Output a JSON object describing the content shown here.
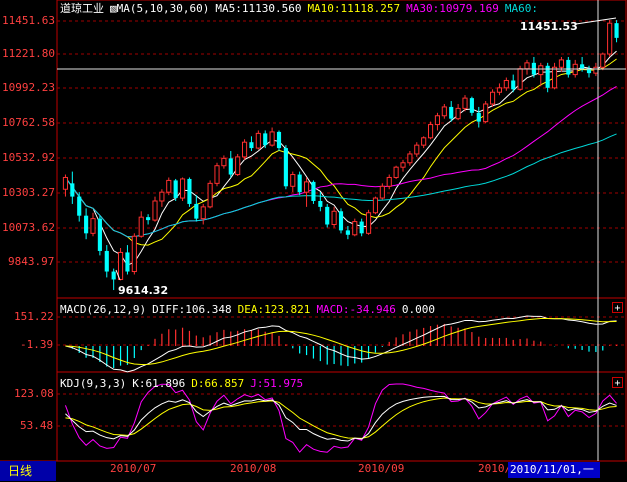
{
  "title": "道琼工业",
  "ma_header": {
    "params": "MA(5,10,30,60)",
    "ma5": "MA5:11130.560",
    "ma10": "MA10:11118.257",
    "ma30": "MA30:10979.169",
    "ma60": "MA60:"
  },
  "macd_header": {
    "params": "MACD(26,12,9)",
    "diff": "DIFF:106.348",
    "dea": "DEA:123.821",
    "macd": "MACD:-34.946",
    "extra": "0.000"
  },
  "kdj_header": {
    "params": "KDJ(9,3,3)",
    "k": "K:61.896",
    "d": "D:66.857",
    "j": "J:51.975"
  },
  "price_axis": [
    "11451.63",
    "11221.80",
    "10992.23",
    "10762.58",
    "10532.92",
    "10303.27",
    "10073.62",
    "9843.97"
  ],
  "macd_axis": [
    "151.22",
    "-1.39"
  ],
  "kdj_axis": [
    "123.08",
    "53.48"
  ],
  "x_axis": [
    "2010/07",
    "2010/08",
    "2010/09",
    "2010/10"
  ],
  "annotations": {
    "high": "11451.53",
    "low": "9614.32"
  },
  "bottom": {
    "period_tab": "日线",
    "cursor_date": "2010/11/01,一"
  },
  "plus_icon": "+",
  "colors": {
    "up": "#ff3030",
    "down": "#00ffff",
    "ma5": "#ffffff",
    "ma10": "#ffff00",
    "ma30": "#ff00ff",
    "ma60": "#00d8d8",
    "grid": "#a00000"
  },
  "chart_data": {
    "type": "candlestick",
    "price_range": [
      9614.32,
      11451.53
    ],
    "candles": [
      {
        "o": 10300,
        "h": 10400,
        "l": 10250,
        "c": 10380
      },
      {
        "o": 10340,
        "h": 10420,
        "l": 10200,
        "c": 10250
      },
      {
        "o": 10250,
        "h": 10280,
        "l": 10080,
        "c": 10120
      },
      {
        "o": 10120,
        "h": 10170,
        "l": 9960,
        "c": 10000
      },
      {
        "o": 10000,
        "h": 10140,
        "l": 9980,
        "c": 10100
      },
      {
        "o": 10100,
        "h": 10120,
        "l": 9850,
        "c": 9880
      },
      {
        "o": 9880,
        "h": 9920,
        "l": 9700,
        "c": 9740
      },
      {
        "o": 9740,
        "h": 9760,
        "l": 9614,
        "c": 9686
      },
      {
        "o": 9686,
        "h": 9900,
        "l": 9680,
        "c": 9870
      },
      {
        "o": 9870,
        "h": 9920,
        "l": 9720,
        "c": 9740
      },
      {
        "o": 9740,
        "h": 10000,
        "l": 9720,
        "c": 9980
      },
      {
        "o": 9980,
        "h": 10150,
        "l": 9970,
        "c": 10110
      },
      {
        "o": 10110,
        "h": 10130,
        "l": 10060,
        "c": 10090
      },
      {
        "o": 10090,
        "h": 10250,
        "l": 10080,
        "c": 10220
      },
      {
        "o": 10220,
        "h": 10300,
        "l": 10180,
        "c": 10280
      },
      {
        "o": 10280,
        "h": 10380,
        "l": 10260,
        "c": 10360
      },
      {
        "o": 10360,
        "h": 10370,
        "l": 10220,
        "c": 10240
      },
      {
        "o": 10240,
        "h": 10380,
        "l": 10220,
        "c": 10370
      },
      {
        "o": 10370,
        "h": 10380,
        "l": 10180,
        "c": 10200
      },
      {
        "o": 10200,
        "h": 10260,
        "l": 10080,
        "c": 10100
      },
      {
        "o": 10100,
        "h": 10200,
        "l": 10060,
        "c": 10180
      },
      {
        "o": 10180,
        "h": 10360,
        "l": 10170,
        "c": 10340
      },
      {
        "o": 10340,
        "h": 10480,
        "l": 10320,
        "c": 10460
      },
      {
        "o": 10460,
        "h": 10530,
        "l": 10440,
        "c": 10510
      },
      {
        "o": 10510,
        "h": 10560,
        "l": 10380,
        "c": 10400
      },
      {
        "o": 10400,
        "h": 10540,
        "l": 10390,
        "c": 10520
      },
      {
        "o": 10520,
        "h": 10640,
        "l": 10500,
        "c": 10620
      },
      {
        "o": 10620,
        "h": 10660,
        "l": 10560,
        "c": 10580
      },
      {
        "o": 10580,
        "h": 10700,
        "l": 10570,
        "c": 10680
      },
      {
        "o": 10680,
        "h": 10700,
        "l": 10580,
        "c": 10600
      },
      {
        "o": 10600,
        "h": 10720,
        "l": 10590,
        "c": 10690
      },
      {
        "o": 10690,
        "h": 10700,
        "l": 10560,
        "c": 10580
      },
      {
        "o": 10580,
        "h": 10600,
        "l": 10300,
        "c": 10320
      },
      {
        "o": 10320,
        "h": 10420,
        "l": 10280,
        "c": 10400
      },
      {
        "o": 10400,
        "h": 10420,
        "l": 10260,
        "c": 10280
      },
      {
        "o": 10280,
        "h": 10380,
        "l": 10180,
        "c": 10350
      },
      {
        "o": 10350,
        "h": 10360,
        "l": 10200,
        "c": 10220
      },
      {
        "o": 10220,
        "h": 10280,
        "l": 10150,
        "c": 10180
      },
      {
        "o": 10180,
        "h": 10200,
        "l": 10040,
        "c": 10060
      },
      {
        "o": 10060,
        "h": 10180,
        "l": 10040,
        "c": 10150
      },
      {
        "o": 10150,
        "h": 10170,
        "l": 10000,
        "c": 10020
      },
      {
        "o": 10020,
        "h": 10050,
        "l": 9960,
        "c": 9990
      },
      {
        "o": 9990,
        "h": 10100,
        "l": 9980,
        "c": 10080
      },
      {
        "o": 10080,
        "h": 10100,
        "l": 9980,
        "c": 10000
      },
      {
        "o": 10000,
        "h": 10160,
        "l": 9990,
        "c": 10140
      },
      {
        "o": 10140,
        "h": 10250,
        "l": 10130,
        "c": 10240
      },
      {
        "o": 10240,
        "h": 10340,
        "l": 10230,
        "c": 10320
      },
      {
        "o": 10320,
        "h": 10400,
        "l": 10300,
        "c": 10380
      },
      {
        "o": 10380,
        "h": 10460,
        "l": 10370,
        "c": 10450
      },
      {
        "o": 10450,
        "h": 10500,
        "l": 10420,
        "c": 10480
      },
      {
        "o": 10480,
        "h": 10560,
        "l": 10460,
        "c": 10540
      },
      {
        "o": 10540,
        "h": 10620,
        "l": 10520,
        "c": 10600
      },
      {
        "o": 10600,
        "h": 10660,
        "l": 10580,
        "c": 10650
      },
      {
        "o": 10650,
        "h": 10760,
        "l": 10640,
        "c": 10740
      },
      {
        "o": 10740,
        "h": 10820,
        "l": 10700,
        "c": 10800
      },
      {
        "o": 10800,
        "h": 10880,
        "l": 10780,
        "c": 10860
      },
      {
        "o": 10860,
        "h": 10900,
        "l": 10760,
        "c": 10780
      },
      {
        "o": 10780,
        "h": 10880,
        "l": 10770,
        "c": 10850
      },
      {
        "o": 10850,
        "h": 10940,
        "l": 10830,
        "c": 10920
      },
      {
        "o": 10920,
        "h": 10930,
        "l": 10800,
        "c": 10820
      },
      {
        "o": 10820,
        "h": 10860,
        "l": 10720,
        "c": 10760
      },
      {
        "o": 10760,
        "h": 10900,
        "l": 10750,
        "c": 10880
      },
      {
        "o": 10880,
        "h": 10980,
        "l": 10860,
        "c": 10960
      },
      {
        "o": 10960,
        "h": 11020,
        "l": 10940,
        "c": 10990
      },
      {
        "o": 10990,
        "h": 11060,
        "l": 10970,
        "c": 11040
      },
      {
        "o": 11040,
        "h": 11080,
        "l": 10960,
        "c": 10980
      },
      {
        "o": 10980,
        "h": 11140,
        "l": 10970,
        "c": 11120
      },
      {
        "o": 11120,
        "h": 11180,
        "l": 11080,
        "c": 11160
      },
      {
        "o": 11160,
        "h": 11200,
        "l": 11060,
        "c": 11080
      },
      {
        "o": 11080,
        "h": 11160,
        "l": 11000,
        "c": 11140
      },
      {
        "o": 11140,
        "h": 11160,
        "l": 10960,
        "c": 10990
      },
      {
        "o": 10990,
        "h": 11160,
        "l": 10980,
        "c": 11130
      },
      {
        "o": 11130,
        "h": 11200,
        "l": 11100,
        "c": 11180
      },
      {
        "o": 11180,
        "h": 11200,
        "l": 11060,
        "c": 11080
      },
      {
        "o": 11080,
        "h": 11180,
        "l": 11060,
        "c": 11150
      },
      {
        "o": 11150,
        "h": 11200,
        "l": 11100,
        "c": 11120
      },
      {
        "o": 11120,
        "h": 11140,
        "l": 11060,
        "c": 11090
      },
      {
        "o": 11090,
        "h": 11160,
        "l": 11070,
        "c": 11130
      },
      {
        "o": 11130,
        "h": 11230,
        "l": 11110,
        "c": 11220
      },
      {
        "o": 11220,
        "h": 11451,
        "l": 11200,
        "c": 11430
      },
      {
        "o": 11430,
        "h": 11451,
        "l": 11300,
        "c": 11330
      }
    ]
  }
}
